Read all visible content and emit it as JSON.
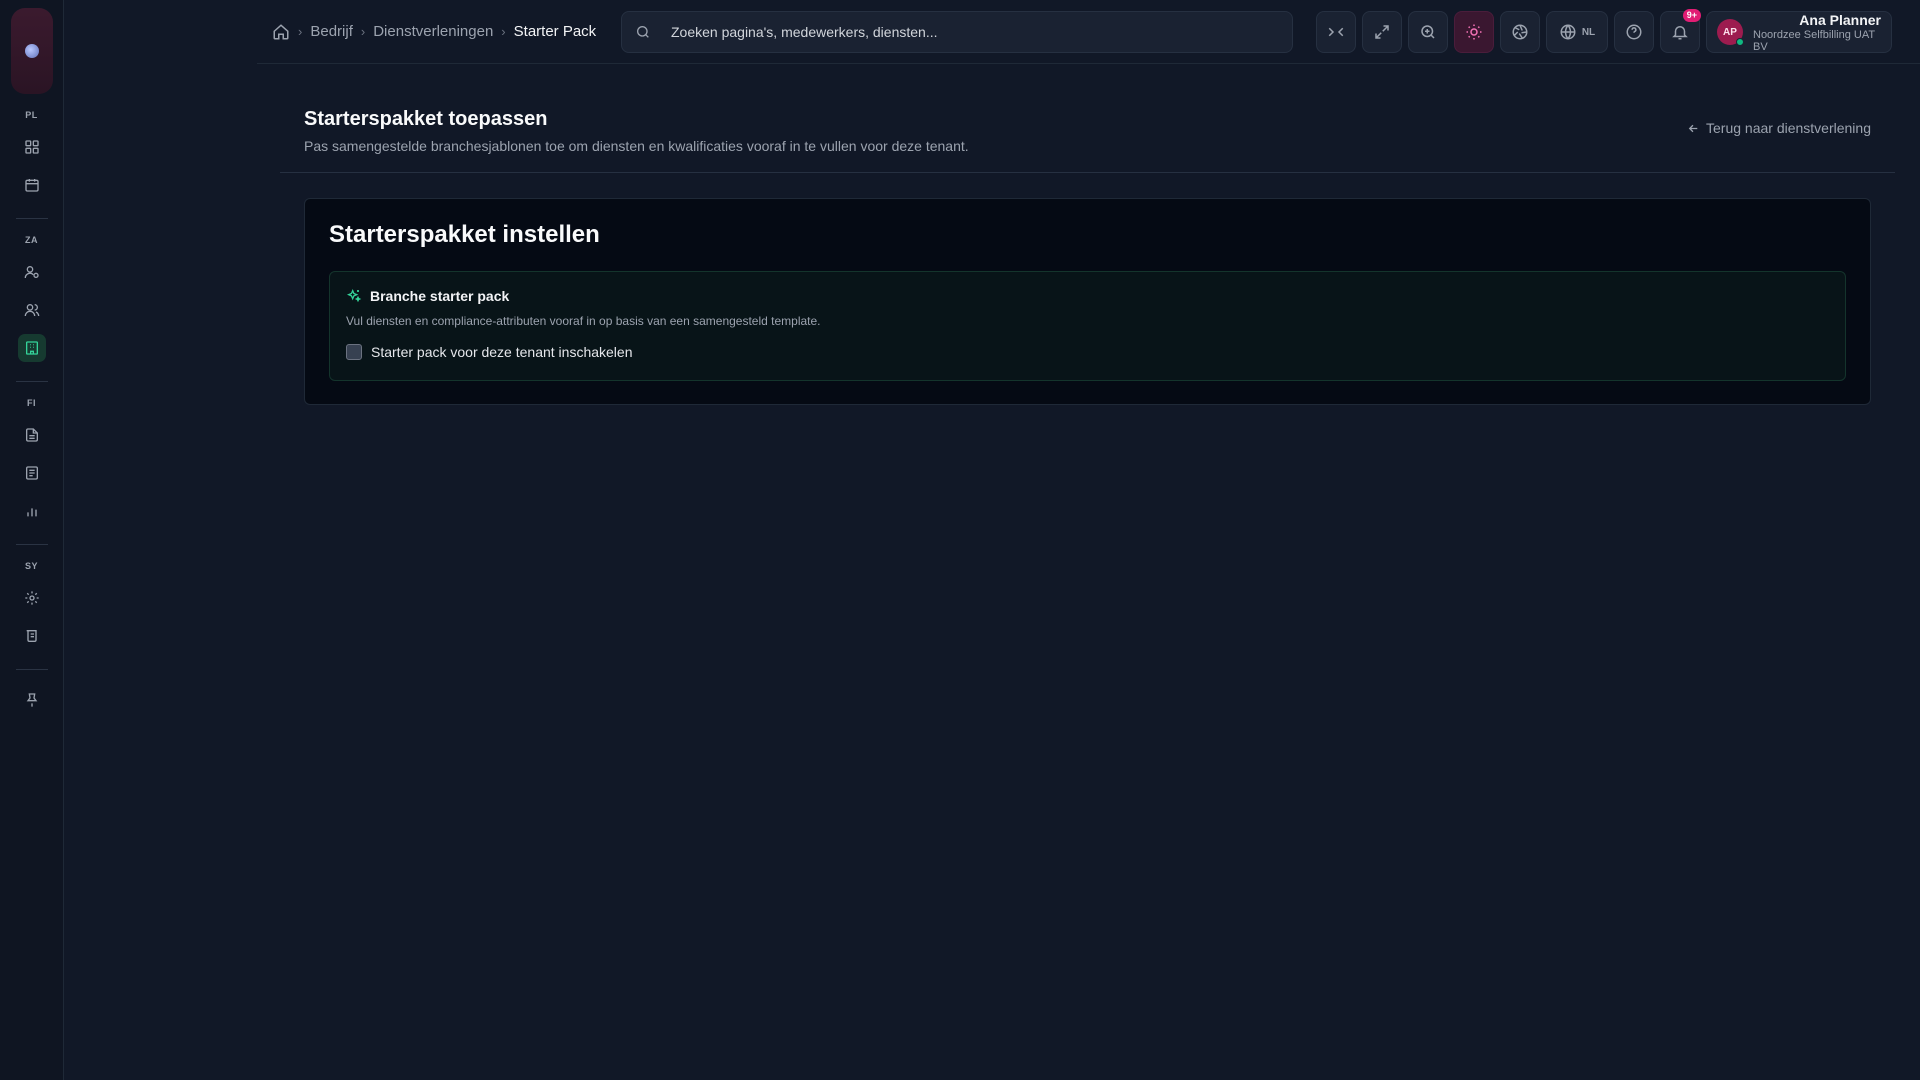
{
  "rail": {
    "groups": [
      "PL",
      "ZA",
      "FI",
      "SY"
    ]
  },
  "breadcrumb": {
    "items": [
      "Bedrijf",
      "Dienstverleningen"
    ],
    "current": "Starter Pack"
  },
  "search": {
    "placeholder": "Zoeken pagina's, medewerkers, diensten..."
  },
  "toolbar": {
    "language": "NL",
    "notifications_badge": "9+"
  },
  "user": {
    "initials": "AP",
    "name": "Ana Planner",
    "org": "Noordzee Selfbilling UAT BV"
  },
  "page": {
    "title": "Starterspakket toepassen",
    "subtitle": "Pas samengestelde branchesjablonen toe om diensten en kwalificaties vooraf in te vullen voor deze tenant.",
    "back_link": "Terug naar dienstverlening"
  },
  "card": {
    "title": "Starterspakket instellen",
    "section": {
      "title": "Branche starter pack",
      "description": "Vul diensten en compliance-attributen vooraf in op basis van een samengesteld template.",
      "checkbox_label": "Starter pack voor deze tenant inschakelen",
      "checked": false
    }
  },
  "colors": {
    "accent": "#34d399",
    "brand": "#e11d74",
    "background": "#111827"
  }
}
